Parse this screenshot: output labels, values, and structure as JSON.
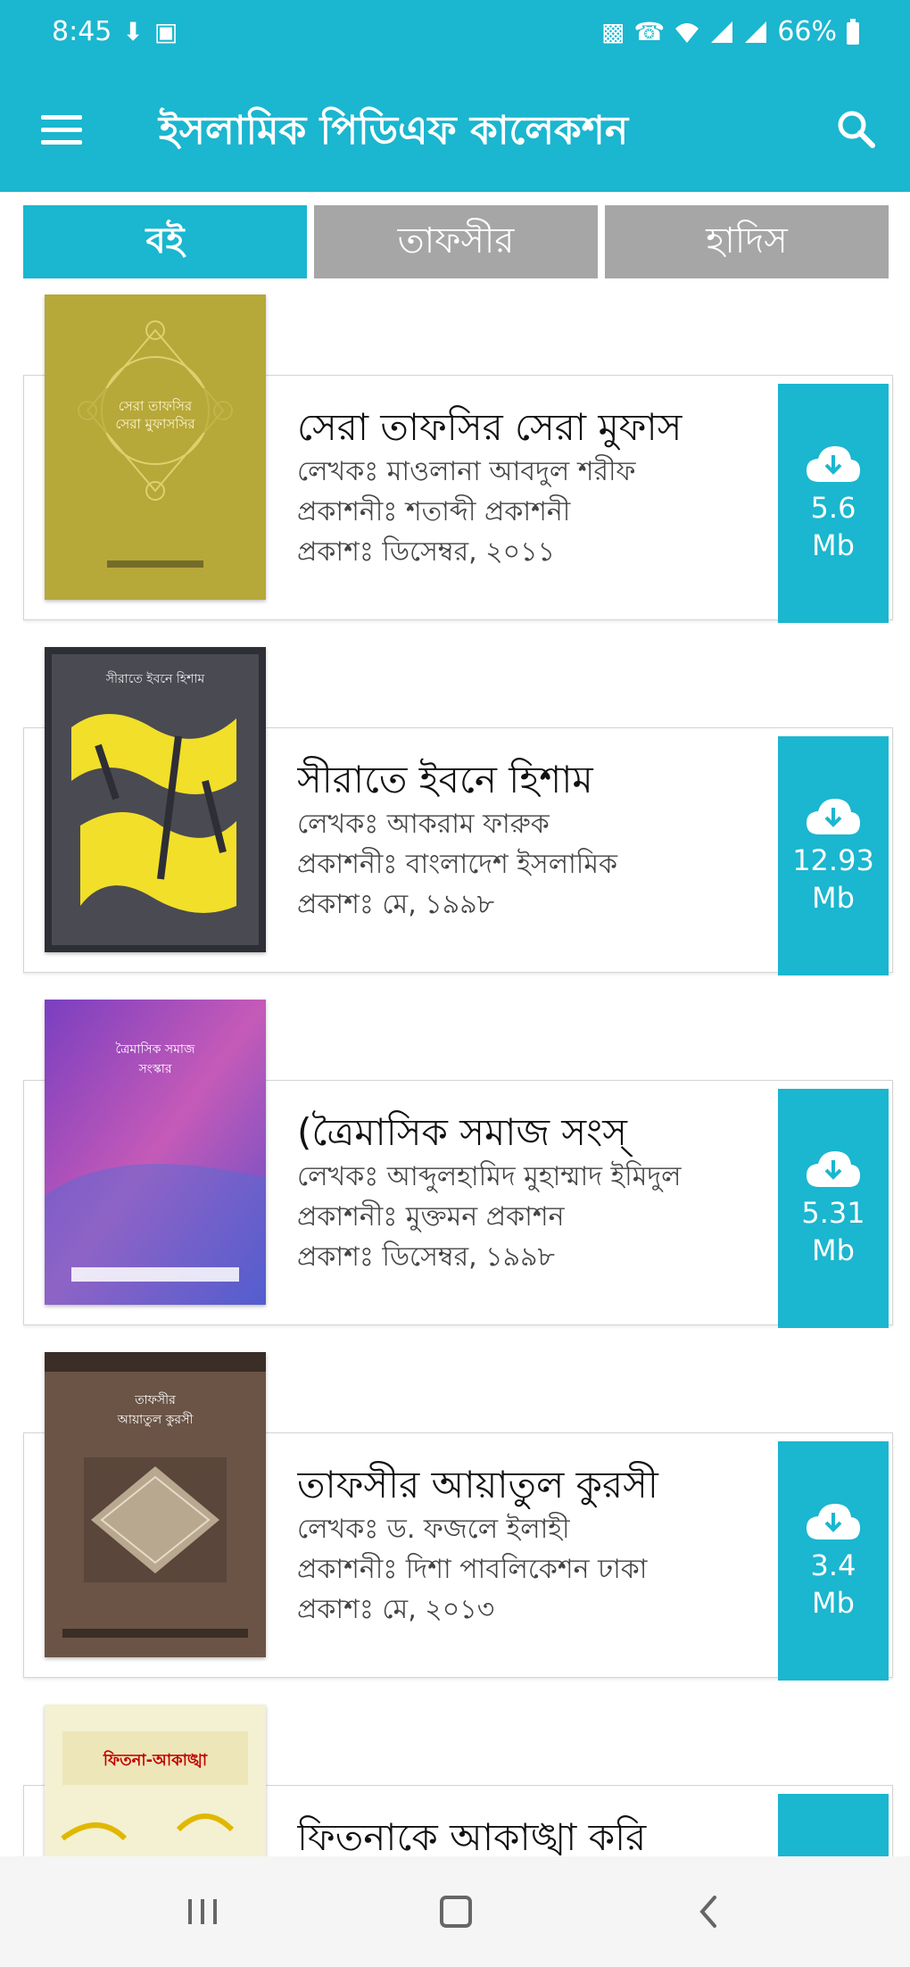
{
  "status_bar": {
    "time": "8:45",
    "battery": "66%",
    "left_icons": [
      "usb-icon",
      "image-icon"
    ],
    "right_icons": [
      "vibrate-icon",
      "wifi-calling-icon",
      "wifi-icon",
      "signal-icon",
      "signal-icon"
    ]
  },
  "app_bar": {
    "title": "ইসলামিক পিডিএফ কালেকশন",
    "color": "#1bb6cf"
  },
  "tabs": [
    {
      "label": "বই",
      "active": true
    },
    {
      "label": "তাফসীর",
      "active": false
    },
    {
      "label": "হাদিস",
      "active": false
    }
  ],
  "books": [
    {
      "title": "    সেরা তাফসির সেরা মুফাস",
      "author": "লেখকঃ মাওলানা আবদুল শরীফ",
      "publisher": "প্রকাশনীঃ শতাব্দী প্রকাশনী",
      "published": "প্রকাশঃ ডিসেম্বর, ২০১১",
      "size": "5.6",
      "unit": "Mb"
    },
    {
      "title": "সীরাতে ইবনে হিশাম",
      "author": "লেখকঃ আকরাম ফারুক",
      "publisher": "প্রকাশনীঃ বাংলাদেশ ইসলামিক",
      "published": "প্রকাশঃ মে, ১৯৯৮",
      "size": "12.93",
      "unit": "Mb"
    },
    {
      "title": "(ত্রৈমাসিক          সমাজ সংস্",
      "author": "লেখকঃ আব্দুলহামিদ মুহাম্মাদ ইমিদুল",
      "publisher": "প্রকাশনীঃ মুক্তমন প্রকাশন",
      "published": "প্রকাশঃ ডিসেম্বর, ১৯৯৮",
      "size": "5.31",
      "unit": "Mb"
    },
    {
      "title": "তাফসীর আয়াতুল কুরসী",
      "author": "লেখকঃ ড. ফজলে ইলাহী",
      "publisher": "প্রকাশনীঃ দিশা পাবলিকেশন ঢাকা",
      "published": "প্রকাশঃ মে, ২০১৩",
      "size": "3.4",
      "unit": "Mb"
    },
    {
      "title": "ফিতনাকে আকাঙ্খা করি",
      "author": "",
      "publisher": "",
      "published": "",
      "size": "",
      "unit": ""
    }
  ],
  "covers": [
    {
      "title": "সেরা তাফসির সেরা মুফাসসির",
      "bg": "#b7a83a",
      "fg": "#fff8d0"
    },
    {
      "title": "সীরাতে ইবনে হিশাম",
      "bg": "#3d3d44",
      "fg": "#f2df2a"
    },
    {
      "title": "ত্রৈমাসিক সমাজ সংস্কার",
      "bg": "#9a4fc4",
      "fg": "#ffffff"
    },
    {
      "title": "তাফসীর আয়াতুল কুরসী",
      "bg": "#6b5446",
      "fg": "#ffffff"
    },
    {
      "title": "ফিতনা-আকাঙ্খা",
      "bg": "#f4f0d2",
      "fg": "#c00000"
    }
  ],
  "nav_bar": {
    "buttons": [
      "recent-apps-icon",
      "home-icon",
      "back-icon"
    ]
  }
}
